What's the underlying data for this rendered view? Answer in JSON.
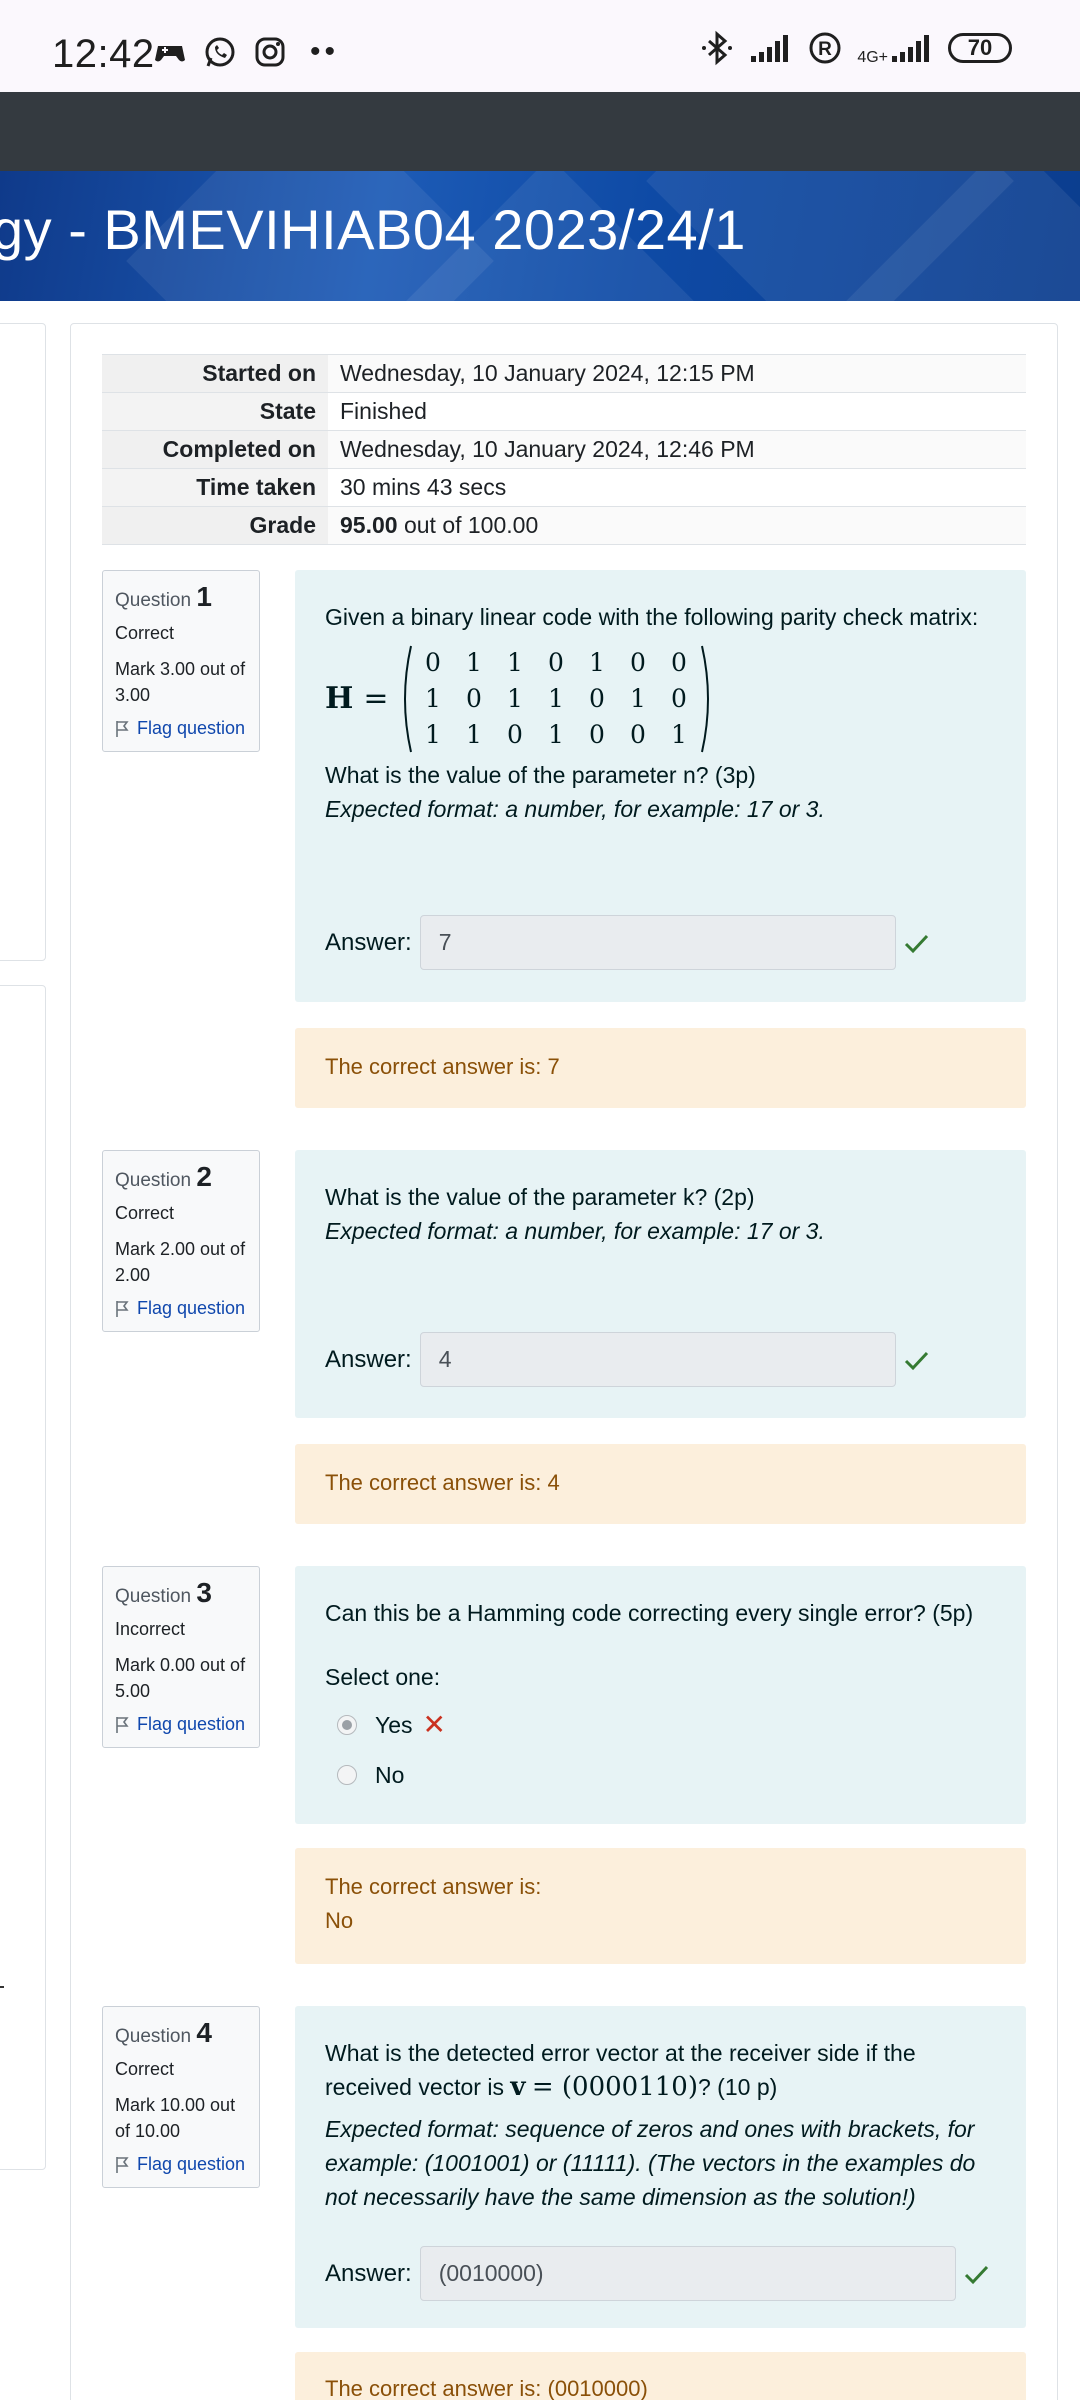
{
  "status_bar": {
    "time": "12:42",
    "network_type": "4G+",
    "battery": "70"
  },
  "course": {
    "title": "gy - BMEVIHIAB04 2023/24/1"
  },
  "summary": {
    "rows": [
      {
        "label": "Started on",
        "value": "Wednesday, 10 January 2024, 12:15 PM"
      },
      {
        "label": "State",
        "value": "Finished"
      },
      {
        "label": "Completed on",
        "value": "Wednesday, 10 January 2024, 12:46 PM"
      },
      {
        "label": "Time taken",
        "value": "30 mins 43 secs"
      }
    ],
    "grade_label": "Grade",
    "grade_value": "95.00",
    "grade_suffix": "out of 100.00"
  },
  "questions": [
    {
      "prefix": "Question",
      "number": "1",
      "state": "Correct",
      "mark": "Mark 3.00 out of 3.00",
      "flag": "Flag question",
      "text": "Given a binary linear code with the following parity check matrix:",
      "matrix_label": "H",
      "matrix_eq": "=",
      "matrix": [
        [
          "0",
          "1",
          "1",
          "0",
          "1",
          "0",
          "0"
        ],
        [
          "1",
          "0",
          "1",
          "1",
          "0",
          "1",
          "0"
        ],
        [
          "1",
          "1",
          "0",
          "1",
          "0",
          "0",
          "1"
        ]
      ],
      "question": "What is the value of the parameter n? (3p)",
      "format": "Expected format: a number, for example: 17 or 3.",
      "answer_label": "Answer:",
      "answer": "7",
      "feedback": "The correct answer is: 7"
    },
    {
      "prefix": "Question",
      "number": "2",
      "state": "Correct",
      "mark": "Mark 2.00 out of 2.00",
      "flag": "Flag question",
      "question": "What is the value of the parameter k? (2p)",
      "format": "Expected format: a number, for example: 17 or 3.",
      "answer_label": "Answer:",
      "answer": "4",
      "feedback": "The correct answer is: 4"
    },
    {
      "prefix": "Question",
      "number": "3",
      "state": "Incorrect",
      "mark": "Mark 0.00 out of 5.00",
      "flag": "Flag question",
      "question": "Can this be a Hamming code correcting every single error? (5p)",
      "select_label": "Select one:",
      "options": [
        "Yes",
        "No"
      ],
      "feedback_line1": "The correct answer is:",
      "feedback_line2": "No"
    },
    {
      "prefix": "Question",
      "number": "4",
      "state": "Correct",
      "mark": "Mark 10.00 out of 10.00",
      "flag": "Flag question",
      "question_a": "What is the detected error vector at the receiver side if the received vector is",
      "question_vec": "v",
      "question_vec_value": "= (0000110)",
      "question_b": "? (10 p)",
      "format": "Expected format: sequence of zeros and ones with brackets, for example: (1001001) or (11111). (The vectors in the examples do not necessarily have the same dimension as the solution!)",
      "answer_label": "Answer:",
      "answer": "(0010000)",
      "feedback": "The correct answer is: (0010000)"
    }
  ]
}
